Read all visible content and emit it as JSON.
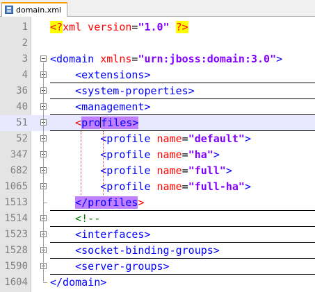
{
  "tab": {
    "label": "domain.xml"
  },
  "lines": [
    {
      "num": "1",
      "tokens": [
        [
          "pi",
          "<?"
        ],
        [
          "attr",
          "xml version"
        ],
        [
          "plain",
          "="
        ],
        [
          "val",
          "\"1.0\""
        ],
        [
          "plain",
          " "
        ],
        [
          "pi",
          "?>"
        ]
      ]
    },
    {
      "num": "2",
      "tokens": []
    },
    {
      "num": "3",
      "tokens": [
        [
          "tag",
          "<domain "
        ],
        [
          "attr",
          "xmlns"
        ],
        [
          "plain",
          "="
        ],
        [
          "val",
          "\"urn:jboss:domain:3.0\""
        ],
        [
          "tag",
          ">"
        ]
      ]
    },
    {
      "num": "4",
      "tokens": [
        [
          "plain",
          "    "
        ],
        [
          "tag",
          "<extensions>"
        ]
      ]
    },
    {
      "num": "36",
      "tokens": [
        [
          "plain",
          "    "
        ],
        [
          "tag",
          "<system-properties>"
        ]
      ]
    },
    {
      "num": "40",
      "tokens": [
        [
          "plain",
          "    "
        ],
        [
          "tag",
          "<management>"
        ]
      ]
    },
    {
      "num": "51",
      "tokens": [
        [
          "plain",
          "    "
        ],
        [
          "matchred",
          "<"
        ],
        [
          "match",
          "pro"
        ],
        [
          "match",
          "files>"
        ]
      ]
    },
    {
      "num": "52",
      "tokens": [
        [
          "plain",
          "        "
        ],
        [
          "tag",
          "<profile "
        ],
        [
          "attr",
          "name"
        ],
        [
          "plain",
          "="
        ],
        [
          "val",
          "\"default\""
        ],
        [
          "tag",
          ">"
        ]
      ]
    },
    {
      "num": "347",
      "tokens": [
        [
          "plain",
          "        "
        ],
        [
          "tag",
          "<profile "
        ],
        [
          "attr",
          "name"
        ],
        [
          "plain",
          "="
        ],
        [
          "val",
          "\"ha\""
        ],
        [
          "tag",
          ">"
        ]
      ]
    },
    {
      "num": "682",
      "tokens": [
        [
          "plain",
          "        "
        ],
        [
          "tag",
          "<profile "
        ],
        [
          "attr",
          "name"
        ],
        [
          "plain",
          "="
        ],
        [
          "val",
          "\"full\""
        ],
        [
          "tag",
          ">"
        ]
      ]
    },
    {
      "num": "1065",
      "tokens": [
        [
          "plain",
          "        "
        ],
        [
          "tag",
          "<profile "
        ],
        [
          "attr",
          "name"
        ],
        [
          "plain",
          "="
        ],
        [
          "val",
          "\"full-ha\""
        ],
        [
          "tag",
          ">"
        ]
      ]
    },
    {
      "num": "1513",
      "tokens": [
        [
          "plain",
          "    "
        ],
        [
          "match",
          "</profiles"
        ],
        [
          "matchred",
          ">"
        ]
      ]
    },
    {
      "num": "1514",
      "tokens": [
        [
          "plain",
          "    "
        ],
        [
          "comment",
          "<!--"
        ]
      ]
    },
    {
      "num": "1523",
      "tokens": [
        [
          "plain",
          "    "
        ],
        [
          "tag",
          "<interfaces>"
        ]
      ]
    },
    {
      "num": "1528",
      "tokens": [
        [
          "plain",
          "    "
        ],
        [
          "tag",
          "<socket-binding-groups>"
        ]
      ]
    },
    {
      "num": "1590",
      "tokens": [
        [
          "plain",
          "    "
        ],
        [
          "tag",
          "<server-groups>"
        ]
      ]
    },
    {
      "num": "1604",
      "tokens": [
        [
          "tag",
          "</domain>"
        ]
      ]
    }
  ],
  "colors": {
    "tag": "#0000ff",
    "attr": "#ff0000",
    "value": "#8000ff",
    "comment": "#008000",
    "current_line": "#e8e8ff",
    "brace_match": "#c080ff",
    "pi_highlight": "#ffff00"
  },
  "icons": {
    "tab_icon": "save-icon"
  }
}
